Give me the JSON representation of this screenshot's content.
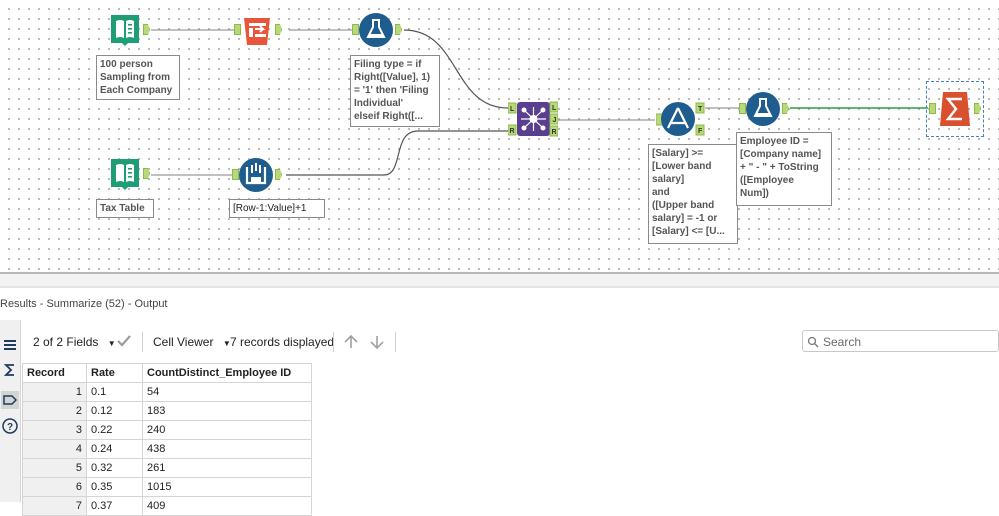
{
  "workflow": {
    "tools": [
      {
        "name": "input-data-tool-1",
        "icon": "book-icon",
        "annotation": "100 person\nSampling from\nEach Company"
      },
      {
        "name": "sample-tool",
        "icon": "sample-icon"
      },
      {
        "name": "formula-tool-1",
        "icon": "flask-icon",
        "annotation": "Filing type = if\nRight([Value], 1)\n= '1' then 'Filing\nIndividual'\nelseif Right([..."
      },
      {
        "name": "join-tool",
        "icon": "join-icon",
        "anchors": [
          "L",
          "J",
          "R"
        ]
      },
      {
        "name": "filter-tool",
        "icon": "filter-icon",
        "anchors": [
          "T",
          "F"
        ],
        "annotation": "[Salary] >=\n[Lower band\nsalary]\nand\n([Upper band\nsalary] = -1 or\n[Salary] <= [U..."
      },
      {
        "name": "formula-tool-2",
        "icon": "flask-icon",
        "annotation": "Employee ID =\n[Company name]\n+ \" - \" + ToString\n([Employee\nNum])"
      },
      {
        "name": "summarize-tool",
        "icon": "sigma-icon"
      },
      {
        "name": "input-data-tool-2",
        "icon": "book-icon",
        "annotation": "Tax Table"
      },
      {
        "name": "multi-row-formula-tool",
        "icon": "multirow-icon",
        "annotation": "[Row-1:Value]+1"
      }
    ]
  },
  "results": {
    "title": "Results - Summarize (52) - Output",
    "fields_label": "2 of 2 Fields",
    "cell_viewer_label": "Cell Viewer",
    "records_label": "7 records displayed",
    "search_placeholder": "Search",
    "columns": [
      "Record",
      "Rate",
      "CountDistinct_Employee ID"
    ],
    "rows": [
      [
        "1",
        "0.1",
        "54"
      ],
      [
        "2",
        "0.12",
        "183"
      ],
      [
        "3",
        "0.22",
        "240"
      ],
      [
        "4",
        "0.24",
        "438"
      ],
      [
        "5",
        "0.32",
        "261"
      ],
      [
        "6",
        "0.35",
        "1015"
      ],
      [
        "7",
        "0.37",
        "409"
      ]
    ]
  },
  "colors": {
    "input_green": "#1f9e76",
    "sample_orange": "#e8553a",
    "formula_blue": "#1f5d8e",
    "summarize_orange": "#d9502e",
    "anchor_green": "#b7d97a",
    "join_purple": "#5a3e8f"
  }
}
